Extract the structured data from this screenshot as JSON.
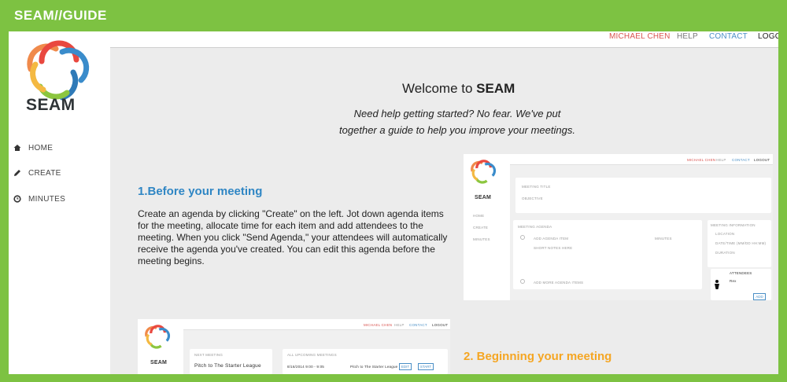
{
  "banner": {
    "title": "SEAM//GUIDE"
  },
  "brand": {
    "name": "SEAM"
  },
  "sidebar": {
    "items": [
      {
        "label": "HOME",
        "icon": "home-icon"
      },
      {
        "label": "CREATE",
        "icon": "pencil-icon"
      },
      {
        "label": "MINUTES",
        "icon": "clock-icon"
      }
    ]
  },
  "topnav": {
    "user": "MICHAEL CHEN",
    "help": "HELP",
    "contact": "CONTACT",
    "logout": "LOGO"
  },
  "main": {
    "welcome_prefix": "Welcome to ",
    "welcome_brand": "SEAM",
    "intro_line1": "Need help getting started? No fear. We've put",
    "intro_line2": "together a guide to help you improve your meetings.",
    "step1_heading": "1.Before your meeting",
    "step1_text": "Create an agenda by clicking \"Create\" on the left. Jot down agenda items for the meeting, allocate time for each item and add attendees to the meeting. When you click \"Send Agenda,\" your attendees will automatically receive the agenda you've created. You can edit this agenda before the meeting begins.",
    "step2_heading": "2. Beginning your meeting"
  },
  "shot1": {
    "top_user": "MICHAEL CHEN",
    "top_help": "HELP",
    "top_contact": "CONTACT",
    "top_logout": "LOGOUT",
    "brand": "SEAM",
    "nav_home": "HOME",
    "nav_create": "CREATE",
    "nav_minutes": "MINUTES",
    "meeting_title_label": "MEETING TITLE",
    "objective_label": "OBJECTIVE",
    "agenda_label": "MEETING AGENDA",
    "add_item": "ADD AGENDA ITEM",
    "minutes_label": "MINUTES",
    "short_notes": "SHORT NOTES HERE",
    "add_more": "ADD MORE AGENDA ITEMS",
    "info_label": "MEETING INFORMATION",
    "location": "LOCATION",
    "date_time": "DATE/TIME (MM/DD HH:MM)",
    "duration": "DURATION",
    "attendees_label": "ATTENDEES",
    "attendee_name": "Rex",
    "add_btn": "ADD"
  },
  "shot2": {
    "top_user": "MICHAEL CHEN",
    "top_help": "HELP",
    "top_contact": "CONTACT",
    "top_logout": "LOGOUT",
    "brand": "SEAM",
    "next_label": "NEXT MEETING",
    "next_title": "Pitch to The Starter League",
    "upcoming_label": "ALL UPCOMING MEETINGS",
    "row_date": "8/16/2014 9:00 - 9:05",
    "row_title": "Pitch to The Starter League",
    "edit_btn": "EDIT",
    "start_btn": "START"
  },
  "colors": {
    "frame_green": "#7dc242",
    "heading_blue": "#2f86c4",
    "heading_orange": "#f5a623",
    "user_red": "#d9534f",
    "link_blue": "#4a8fc6"
  }
}
